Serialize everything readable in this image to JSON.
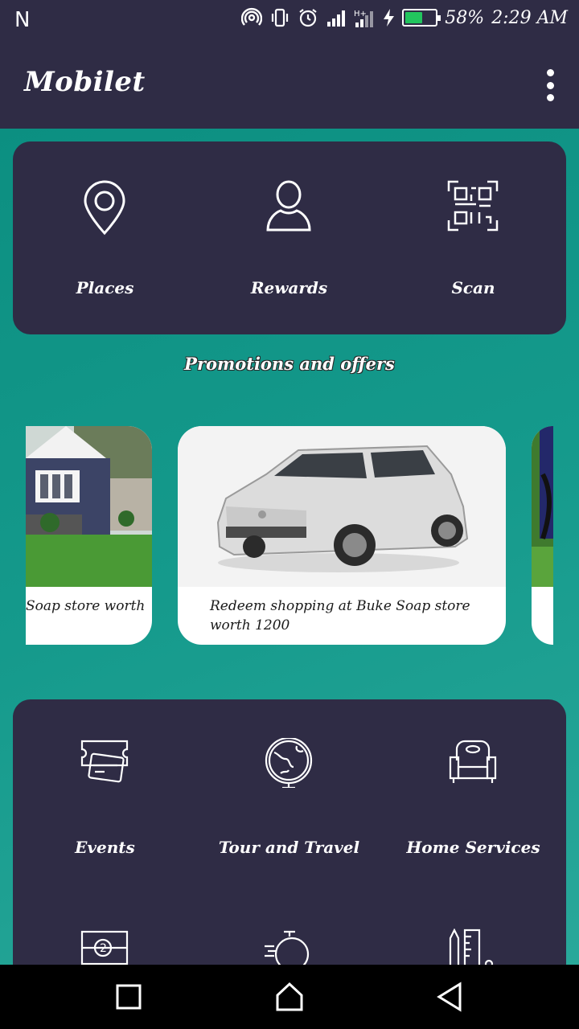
{
  "status_bar": {
    "carrier": "N",
    "battery_percent": "58%",
    "battery_level": 0.58,
    "time": "2:29 AM",
    "icons": [
      "hotspot-icon",
      "vibrate-icon",
      "alarm-icon",
      "signal-icon",
      "signal-h-icon",
      "charging-icon",
      "battery-icon"
    ]
  },
  "app_bar": {
    "title": "Mobilet",
    "menu_icon": "more-vert-icon"
  },
  "quick_actions": [
    {
      "label": "Places",
      "icon": "location-pin-icon"
    },
    {
      "label": "Rewards",
      "icon": "user-icon"
    },
    {
      "label": "Scan",
      "icon": "qr-code-icon"
    }
  ],
  "promotions": {
    "title": "Promotions and offers",
    "cards": [
      {
        "caption": "Soap store worth",
        "image": "house-photo"
      },
      {
        "caption": "Redeem shopping at Buke Soap store worth 1200",
        "image": "car-photo"
      },
      {
        "caption": "",
        "image": "bike-photo"
      }
    ]
  },
  "categories": [
    {
      "label": "Events",
      "icon": "ticket-icon"
    },
    {
      "label": "Tour and Travel",
      "icon": "globe-icon"
    },
    {
      "label": "Home Services",
      "icon": "armchair-icon"
    },
    {
      "label": "",
      "icon": "coupon-icon"
    },
    {
      "label": "",
      "icon": "stopwatch-icon"
    },
    {
      "label": "",
      "icon": "ruler-pencil-icon"
    }
  ],
  "nav_bar": [
    "recents-button",
    "home-button",
    "back-button"
  ],
  "colors": {
    "bar": "#2f2c45",
    "teal": "#0c8f81",
    "battery_fill": "#22c55e"
  }
}
